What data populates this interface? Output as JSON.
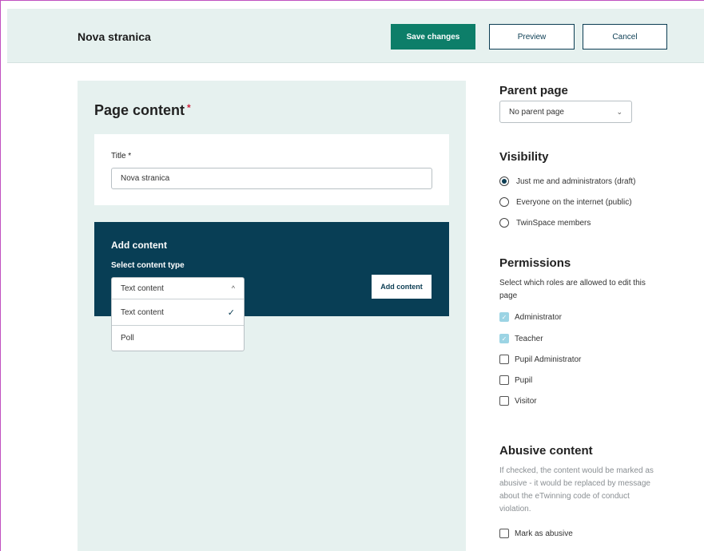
{
  "header": {
    "page_name": "Nova stranica",
    "save_label": "Save changes",
    "preview_label": "Preview",
    "cancel_label": "Cancel"
  },
  "content": {
    "section_title": "Page content",
    "required_mark": "*",
    "title_label": "Title *",
    "title_value": "Nova stranica",
    "add_title": "Add content",
    "select_label": "Select content type",
    "add_button": "Add content",
    "dropdown": {
      "selected": "Text content",
      "chevron": "^",
      "options": [
        {
          "label": "Text content",
          "check": "✓"
        },
        {
          "label": "Poll"
        }
      ]
    }
  },
  "sidebar": {
    "parent": {
      "heading": "Parent page",
      "value": "No parent page",
      "chevron": "⌄"
    },
    "visibility": {
      "heading": "Visibility",
      "options": [
        {
          "label": "Just me and administrators (draft)",
          "selected": true
        },
        {
          "label": "Everyone on the internet (public)",
          "selected": false
        },
        {
          "label": "TwinSpace members",
          "selected": false
        }
      ]
    },
    "permissions": {
      "heading": "Permissions",
      "description": "Select which roles are allowed to edit this page",
      "roles": [
        {
          "label": "Administrator",
          "checked": true
        },
        {
          "label": "Teacher",
          "checked": true
        },
        {
          "label": "Pupil Administrator",
          "checked": false
        },
        {
          "label": "Pupil",
          "checked": false
        },
        {
          "label": "Visitor",
          "checked": false
        }
      ]
    },
    "abusive": {
      "heading": "Abusive content",
      "description": "If checked, the content would be marked as abusive - it would be replaced by message about the eTwinning code of conduct violation.",
      "checkbox_label": "Mark as abusive"
    }
  },
  "colors": {
    "accent": "#0d7e69",
    "dark_panel": "#083e55",
    "light_panel": "#e6f1ef",
    "required": "#d0223c"
  }
}
